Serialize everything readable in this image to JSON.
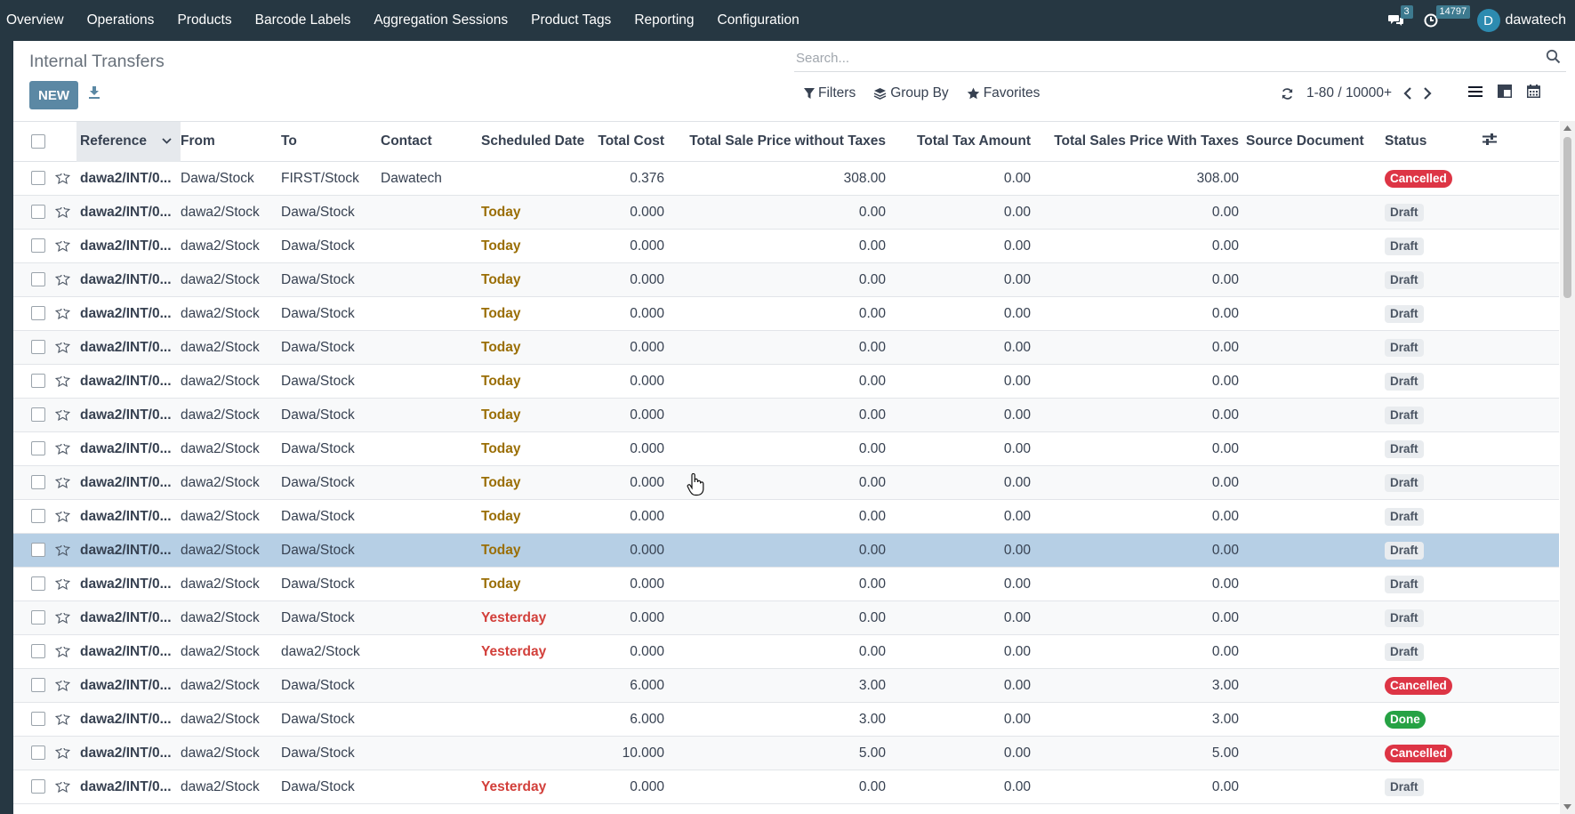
{
  "navbar": {
    "menu": [
      "Overview",
      "Operations",
      "Products",
      "Barcode Labels",
      "Aggregation Sessions",
      "Product Tags",
      "Reporting",
      "Configuration"
    ],
    "messages_count": "3",
    "activities_count": "14797",
    "user_initial": "D",
    "user_name": "dawatech"
  },
  "control_panel": {
    "title": "Internal Transfers",
    "new_label": "NEW",
    "search_placeholder": "Search...",
    "filters_label": "Filters",
    "group_by_label": "Group By",
    "favorites_label": "Favorites",
    "pager_value": "1-80 / 10000+"
  },
  "columns": [
    "Reference",
    "From",
    "To",
    "Contact",
    "Scheduled Date",
    "Total Cost",
    "Total Sale Price without Taxes",
    "Total Tax Amount",
    "Total Sales Price With Taxes",
    "Source Document",
    "Status"
  ],
  "rows": [
    {
      "ref": "dawa2/INT/0...",
      "from": "Dawa/Stock",
      "to": "FIRST/Stock",
      "contact": "Dawatech",
      "date": "",
      "date_kind": "",
      "cost": "0.376",
      "sale": "308.00",
      "tax": "0.00",
      "sale_tax": "308.00",
      "src": "",
      "status": "Cancelled",
      "status_kind": "cancelled"
    },
    {
      "ref": "dawa2/INT/0...",
      "from": "dawa2/Stock",
      "to": "Dawa/Stock",
      "contact": "",
      "date": "Today",
      "date_kind": "today",
      "cost": "0.000",
      "sale": "0.00",
      "tax": "0.00",
      "sale_tax": "0.00",
      "src": "",
      "status": "Draft",
      "status_kind": "draft"
    },
    {
      "ref": "dawa2/INT/0...",
      "from": "dawa2/Stock",
      "to": "Dawa/Stock",
      "contact": "",
      "date": "Today",
      "date_kind": "today",
      "cost": "0.000",
      "sale": "0.00",
      "tax": "0.00",
      "sale_tax": "0.00",
      "src": "",
      "status": "Draft",
      "status_kind": "draft"
    },
    {
      "ref": "dawa2/INT/0...",
      "from": "dawa2/Stock",
      "to": "Dawa/Stock",
      "contact": "",
      "date": "Today",
      "date_kind": "today",
      "cost": "0.000",
      "sale": "0.00",
      "tax": "0.00",
      "sale_tax": "0.00",
      "src": "",
      "status": "Draft",
      "status_kind": "draft"
    },
    {
      "ref": "dawa2/INT/0...",
      "from": "dawa2/Stock",
      "to": "Dawa/Stock",
      "contact": "",
      "date": "Today",
      "date_kind": "today",
      "cost": "0.000",
      "sale": "0.00",
      "tax": "0.00",
      "sale_tax": "0.00",
      "src": "",
      "status": "Draft",
      "status_kind": "draft"
    },
    {
      "ref": "dawa2/INT/0...",
      "from": "dawa2/Stock",
      "to": "Dawa/Stock",
      "contact": "",
      "date": "Today",
      "date_kind": "today",
      "cost": "0.000",
      "sale": "0.00",
      "tax": "0.00",
      "sale_tax": "0.00",
      "src": "",
      "status": "Draft",
      "status_kind": "draft"
    },
    {
      "ref": "dawa2/INT/0...",
      "from": "dawa2/Stock",
      "to": "Dawa/Stock",
      "contact": "",
      "date": "Today",
      "date_kind": "today",
      "cost": "0.000",
      "sale": "0.00",
      "tax": "0.00",
      "sale_tax": "0.00",
      "src": "",
      "status": "Draft",
      "status_kind": "draft"
    },
    {
      "ref": "dawa2/INT/0...",
      "from": "dawa2/Stock",
      "to": "Dawa/Stock",
      "contact": "",
      "date": "Today",
      "date_kind": "today",
      "cost": "0.000",
      "sale": "0.00",
      "tax": "0.00",
      "sale_tax": "0.00",
      "src": "",
      "status": "Draft",
      "status_kind": "draft"
    },
    {
      "ref": "dawa2/INT/0...",
      "from": "dawa2/Stock",
      "to": "Dawa/Stock",
      "contact": "",
      "date": "Today",
      "date_kind": "today",
      "cost": "0.000",
      "sale": "0.00",
      "tax": "0.00",
      "sale_tax": "0.00",
      "src": "",
      "status": "Draft",
      "status_kind": "draft"
    },
    {
      "ref": "dawa2/INT/0...",
      "from": "dawa2/Stock",
      "to": "Dawa/Stock",
      "contact": "",
      "date": "Today",
      "date_kind": "today",
      "cost": "0.000",
      "sale": "0.00",
      "tax": "0.00",
      "sale_tax": "0.00",
      "src": "",
      "status": "Draft",
      "status_kind": "draft"
    },
    {
      "ref": "dawa2/INT/0...",
      "from": "dawa2/Stock",
      "to": "Dawa/Stock",
      "contact": "",
      "date": "Today",
      "date_kind": "today",
      "cost": "0.000",
      "sale": "0.00",
      "tax": "0.00",
      "sale_tax": "0.00",
      "src": "",
      "status": "Draft",
      "status_kind": "draft"
    },
    {
      "ref": "dawa2/INT/0...",
      "from": "dawa2/Stock",
      "to": "Dawa/Stock",
      "contact": "",
      "date": "Today",
      "date_kind": "today",
      "cost": "0.000",
      "sale": "0.00",
      "tax": "0.00",
      "sale_tax": "0.00",
      "src": "",
      "status": "Draft",
      "status_kind": "draft",
      "selected": true
    },
    {
      "ref": "dawa2/INT/0...",
      "from": "dawa2/Stock",
      "to": "Dawa/Stock",
      "contact": "",
      "date": "Today",
      "date_kind": "today",
      "cost": "0.000",
      "sale": "0.00",
      "tax": "0.00",
      "sale_tax": "0.00",
      "src": "",
      "status": "Draft",
      "status_kind": "draft"
    },
    {
      "ref": "dawa2/INT/0...",
      "from": "dawa2/Stock",
      "to": "Dawa/Stock",
      "contact": "",
      "date": "Yesterday",
      "date_kind": "yesterday",
      "cost": "0.000",
      "sale": "0.00",
      "tax": "0.00",
      "sale_tax": "0.00",
      "src": "",
      "status": "Draft",
      "status_kind": "draft"
    },
    {
      "ref": "dawa2/INT/0...",
      "from": "dawa2/Stock",
      "to": "dawa2/Stock",
      "contact": "",
      "date": "Yesterday",
      "date_kind": "yesterday",
      "cost": "0.000",
      "sale": "0.00",
      "tax": "0.00",
      "sale_tax": "0.00",
      "src": "",
      "status": "Draft",
      "status_kind": "draft"
    },
    {
      "ref": "dawa2/INT/0...",
      "from": "dawa2/Stock",
      "to": "Dawa/Stock",
      "contact": "",
      "date": "",
      "date_kind": "",
      "cost": "6.000",
      "sale": "3.00",
      "tax": "0.00",
      "sale_tax": "3.00",
      "src": "",
      "status": "Cancelled",
      "status_kind": "cancelled"
    },
    {
      "ref": "dawa2/INT/0...",
      "from": "dawa2/Stock",
      "to": "Dawa/Stock",
      "contact": "",
      "date": "",
      "date_kind": "",
      "cost": "6.000",
      "sale": "3.00",
      "tax": "0.00",
      "sale_tax": "3.00",
      "src": "",
      "status": "Done",
      "status_kind": "done"
    },
    {
      "ref": "dawa2/INT/0...",
      "from": "dawa2/Stock",
      "to": "Dawa/Stock",
      "contact": "",
      "date": "",
      "date_kind": "",
      "cost": "10.000",
      "sale": "5.00",
      "tax": "0.00",
      "sale_tax": "5.00",
      "src": "",
      "status": "Cancelled",
      "status_kind": "cancelled"
    },
    {
      "ref": "dawa2/INT/0...",
      "from": "dawa2/Stock",
      "to": "Dawa/Stock",
      "contact": "",
      "date": "Yesterday",
      "date_kind": "yesterday",
      "cost": "0.000",
      "sale": "0.00",
      "tax": "0.00",
      "sale_tax": "0.00",
      "src": "",
      "status": "Draft",
      "status_kind": "draft"
    }
  ],
  "colors": {
    "navbar": "#263742",
    "primary": "#5b88a4",
    "today": "#9a6e05",
    "yesterday": "#d23f3a",
    "cancelled": "#dd3545",
    "done": "#26a244",
    "selected_row": "#b6cfe5"
  },
  "icons": {
    "messages": "chat-bubbles-icon",
    "activities": "clock-icon",
    "download": "download-icon",
    "search": "search-icon",
    "filters": "filter-icon",
    "group_by": "layers-icon",
    "favorites": "star-icon",
    "refresh": "refresh-icon",
    "prev": "chevron-left-icon",
    "next": "chevron-right-icon",
    "list_view": "list-view-icon",
    "kanban_view": "kanban-view-icon",
    "calendar_view": "calendar-view-icon",
    "optional_columns": "sliders-icon",
    "row_star": "star-outline-icon"
  }
}
